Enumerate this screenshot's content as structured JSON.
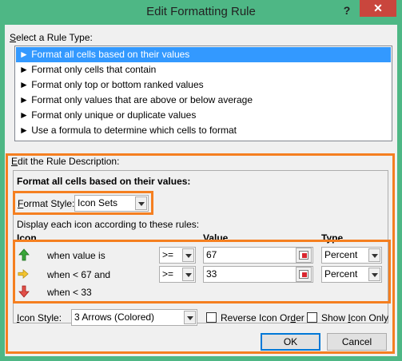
{
  "window": {
    "title": "Edit Formatting Rule",
    "help_label": "?",
    "close_label": "✕"
  },
  "rule_type": {
    "label_prefix": "",
    "label_accel": "S",
    "label_rest": "elect a Rule Type:",
    "items": [
      {
        "label": "► Format all cells based on their values",
        "selected": true
      },
      {
        "label": "► Format only cells that contain",
        "selected": false
      },
      {
        "label": "► Format only top or bottom ranked values",
        "selected": false
      },
      {
        "label": "► Format only values that are above or below average",
        "selected": false
      },
      {
        "label": "► Format only unique or duplicate values",
        "selected": false
      },
      {
        "label": "► Use a formula to determine which cells to format",
        "selected": false
      }
    ]
  },
  "description": {
    "label_accel": "E",
    "label_rest": "dit the Rule Description:",
    "heading": "Format all cells based on their values:",
    "format_style_accel": "F",
    "format_style_rest": "ormat Style:",
    "format_style_value": "Icon Sets",
    "display_text": "Display each icon according to these rules:",
    "col_icon": "Icon",
    "col_value": "Value",
    "col_type": "Type",
    "rules": [
      {
        "icon": "green-up-arrow-icon",
        "text": "when value is",
        "operator": ">=",
        "value": "67",
        "type": "Percent"
      },
      {
        "icon": "yellow-right-arrow-icon",
        "text": "when < 67 and",
        "operator": ">=",
        "value": "33",
        "type": "Percent"
      },
      {
        "icon": "red-down-arrow-icon",
        "text": "when < 33"
      }
    ],
    "icon_style_accel": "I",
    "icon_style_rest": "con Style:",
    "icon_style_value": "3 Arrows (Colored)",
    "reverse_label_pre": "Reverse Icon Or",
    "reverse_label_accel": "d",
    "reverse_label_post": "er",
    "show_label_pre": "Show ",
    "show_label_accel": "I",
    "show_label_post": "con Only"
  },
  "buttons": {
    "ok": "OK",
    "cancel": "Cancel"
  },
  "colors": {
    "window_frame": "#4eb785",
    "selection": "#3399ff",
    "highlight": "#f57f20",
    "close": "#c9463d"
  }
}
